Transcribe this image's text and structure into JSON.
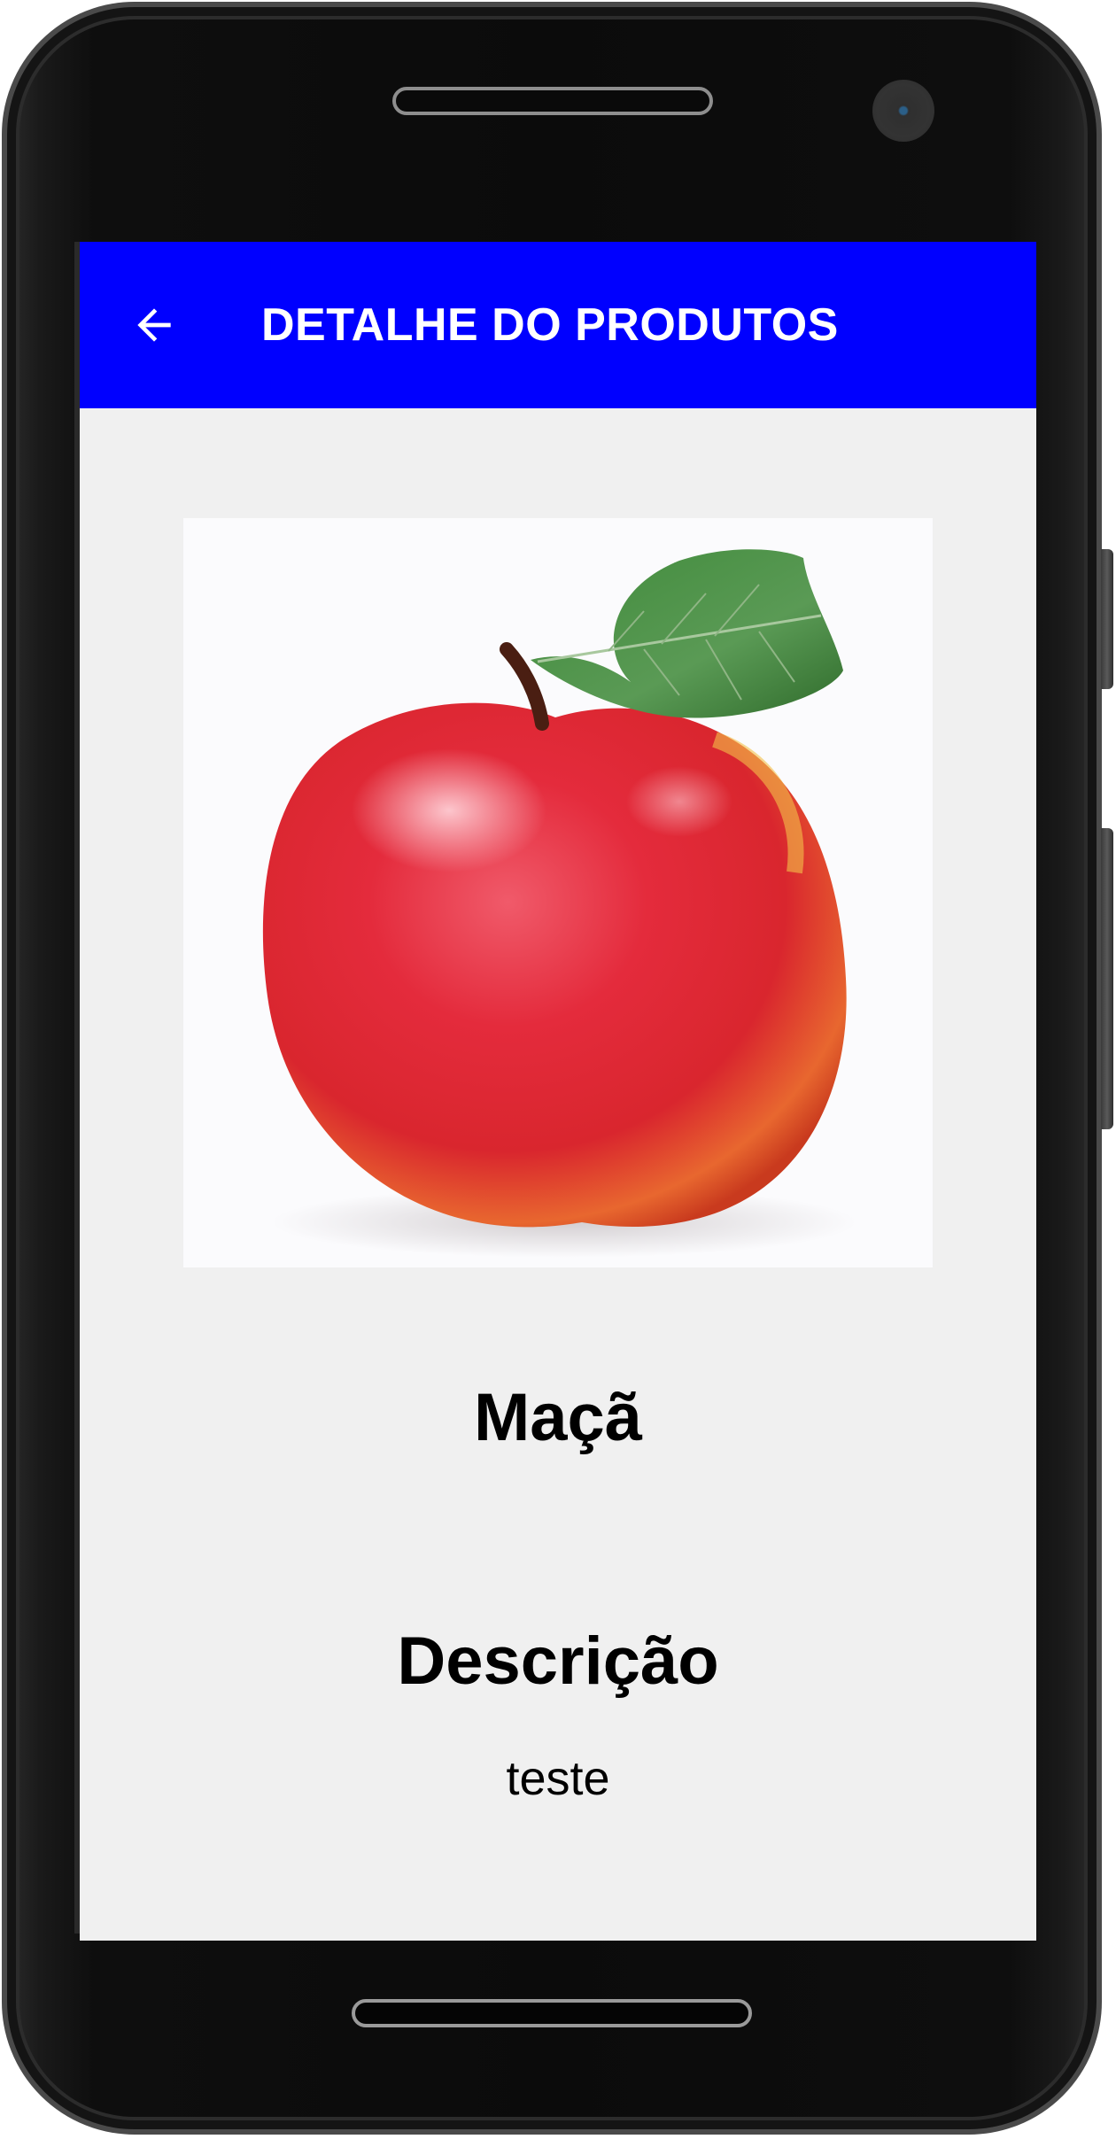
{
  "app_bar": {
    "title": "DETALHE DO PRODUTOS",
    "back_icon": "arrow-left-icon",
    "background_color": "#0000ff",
    "text_color": "#ffffff"
  },
  "product": {
    "image_subject": "red apple with leaf",
    "name": "Maçã",
    "description_heading": "Descrição",
    "description": "teste"
  },
  "screen": {
    "background_color": "#f0f0f0"
  }
}
